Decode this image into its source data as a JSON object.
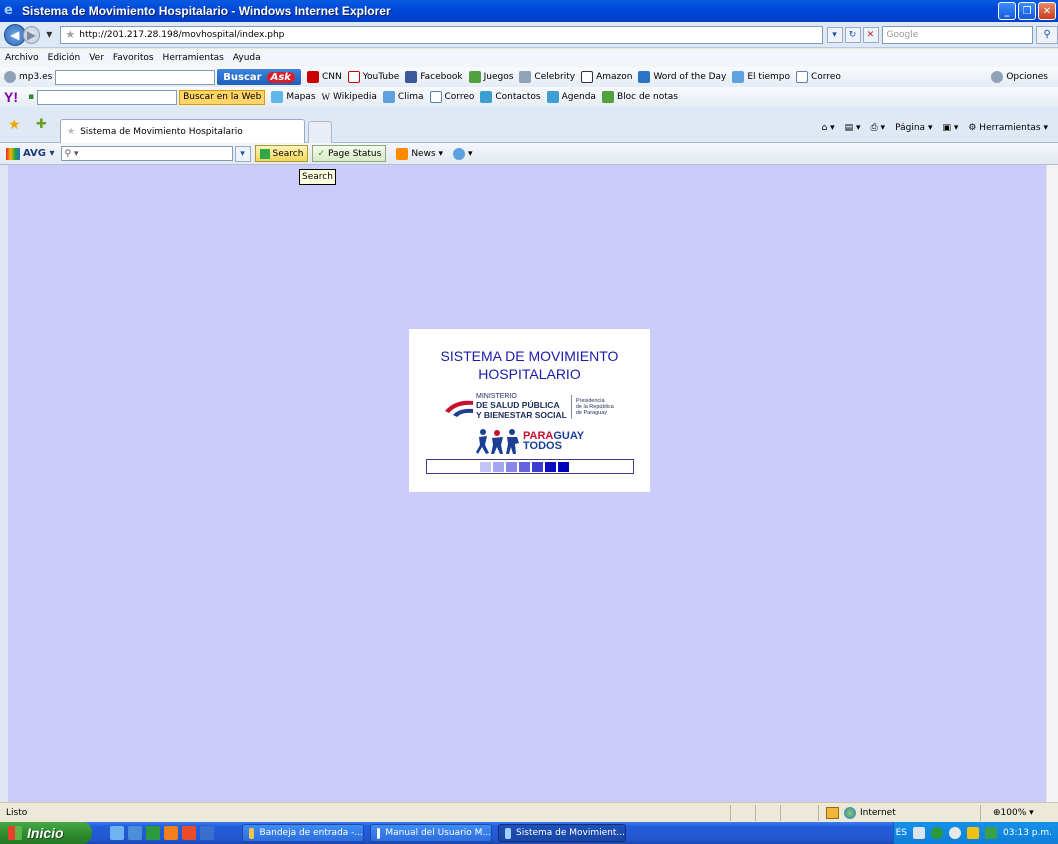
{
  "window": {
    "title": "Sistema de Movimiento Hospitalario - Windows Internet Explorer"
  },
  "addressbar": {
    "url": "http://201.217.28.198/movhospital/index.php",
    "search_placeholder": "Google"
  },
  "menu": [
    "Archivo",
    "Edición",
    "Ver",
    "Favoritos",
    "Herramientas",
    "Ayuda"
  ],
  "toolbar1": {
    "site": "mp3.es",
    "search_button": "Buscar",
    "search_brand": "Ask",
    "links": [
      "CNN",
      "YouTube",
      "Facebook",
      "Juegos",
      "Celebrity",
      "Amazon",
      "Word of the Day",
      "El tiempo",
      "Correo"
    ],
    "options": "Opciones"
  },
  "toolbar2": {
    "search_button": "Buscar en la Web",
    "links": [
      "Mapas",
      "Wikipedia",
      "Clima",
      "Correo",
      "Contactos",
      "Agenda",
      "Bloc de notas"
    ]
  },
  "tabs": {
    "active": "Sistema de Movimiento Hospitalario",
    "commands": [
      "Página",
      "Herramientas"
    ]
  },
  "avg": {
    "brand": "AVG",
    "search_button": "Search",
    "page_status": "Page Status",
    "news": "News"
  },
  "tooltip": "Search",
  "page": {
    "title_line1": "SISTEMA DE MOVIMIENTO",
    "title_line2": "HOSPITALARIO",
    "ministerio_line1": "MINISTERIO",
    "ministerio_line2": "DE SALUD PÚBLICA",
    "ministerio_line3": "Y BIENESTAR SOCIAL",
    "presidencia_line1": "Presidencia",
    "presidencia_line2": "de la República",
    "presidencia_line3": "de Paraguay",
    "paraguay_red": "PARA",
    "paraguay_blue": "GUAY",
    "todos": "TODOS",
    "background": "#ccccfa",
    "title_color": "#1a1aa8"
  },
  "status": {
    "text": "Listo",
    "zone": "Internet",
    "zoom": "100%"
  },
  "taskbar": {
    "start": "Inicio",
    "tasks": [
      "Bandeja de entrada -...",
      "Manual del Usuario M...",
      "Sistema de Movimient..."
    ],
    "lang": "ES",
    "clock": "03:13 p.m."
  }
}
